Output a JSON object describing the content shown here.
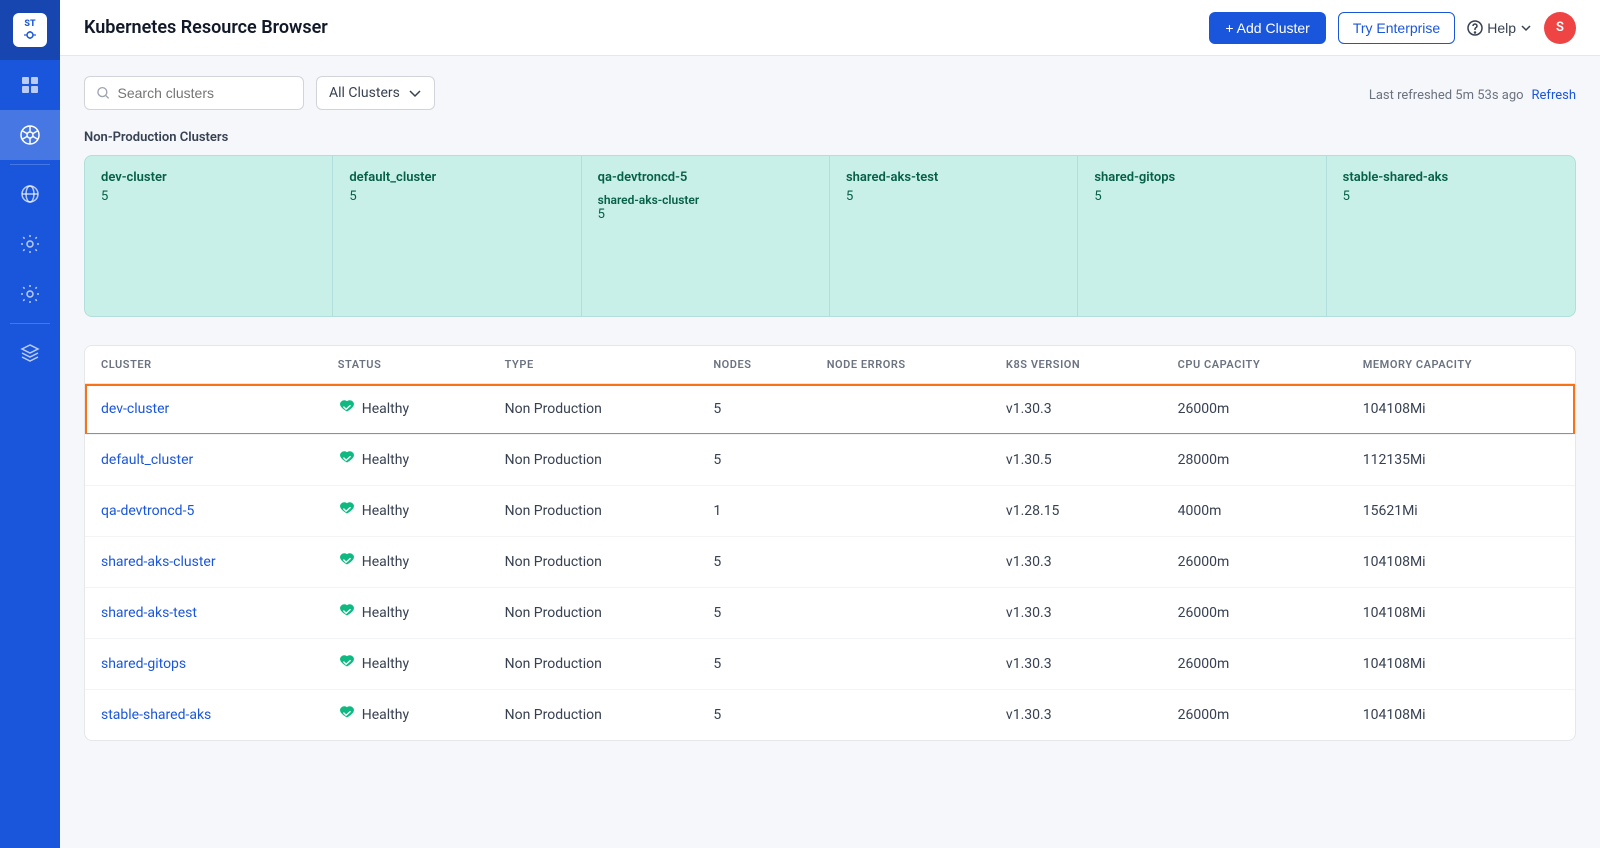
{
  "app": {
    "title": "Kubernetes Resource Browser",
    "logo_text": "ST",
    "avatar_letter": "S"
  },
  "topbar": {
    "add_cluster_label": "+ Add Cluster",
    "try_enterprise_label": "Try Enterprise",
    "help_label": "Help",
    "avatar_letter": "S"
  },
  "filter": {
    "search_placeholder": "Search clusters",
    "cluster_filter_label": "All Clusters",
    "refresh_text": "Last refreshed 5m 53s ago",
    "refresh_label": "Refresh"
  },
  "cluster_cards_section": {
    "title": "Non-Production Clusters",
    "cards": [
      {
        "name": "dev-cluster",
        "count": "5"
      },
      {
        "name": "default_cluster",
        "count": "5"
      },
      {
        "name": "qa-devtroncd-5",
        "count": "",
        "sub_name": "shared-aks-cluster",
        "sub_count": "5"
      },
      {
        "name": "shared-aks-test",
        "count": "5"
      },
      {
        "name": "shared-gitops",
        "count": "5"
      },
      {
        "name": "stable-shared-aks",
        "count": "5"
      }
    ]
  },
  "table": {
    "columns": [
      "CLUSTER",
      "STATUS",
      "TYPE",
      "NODES",
      "NODE ERRORS",
      "K8S VERSION",
      "CPU CAPACITY",
      "MEMORY CAPACITY"
    ],
    "rows": [
      {
        "cluster": "dev-cluster",
        "status": "Healthy",
        "type": "Non Production",
        "nodes": "5",
        "node_errors": "",
        "k8s_version": "v1.30.3",
        "cpu_capacity": "26000m",
        "memory_capacity": "104108Mi",
        "selected": true
      },
      {
        "cluster": "default_cluster",
        "status": "Healthy",
        "type": "Non Production",
        "nodes": "5",
        "node_errors": "",
        "k8s_version": "v1.30.5",
        "cpu_capacity": "28000m",
        "memory_capacity": "112135Mi",
        "selected": false
      },
      {
        "cluster": "qa-devtroncd-5",
        "status": "Healthy",
        "type": "Non Production",
        "nodes": "1",
        "node_errors": "",
        "k8s_version": "v1.28.15",
        "cpu_capacity": "4000m",
        "memory_capacity": "15621Mi",
        "selected": false
      },
      {
        "cluster": "shared-aks-cluster",
        "status": "Healthy",
        "type": "Non Production",
        "nodes": "5",
        "node_errors": "",
        "k8s_version": "v1.30.3",
        "cpu_capacity": "26000m",
        "memory_capacity": "104108Mi",
        "selected": false
      },
      {
        "cluster": "shared-aks-test",
        "status": "Healthy",
        "type": "Non Production",
        "nodes": "5",
        "node_errors": "",
        "k8s_version": "v1.30.3",
        "cpu_capacity": "26000m",
        "memory_capacity": "104108Mi",
        "selected": false
      },
      {
        "cluster": "shared-gitops",
        "status": "Healthy",
        "type": "Non Production",
        "nodes": "5",
        "node_errors": "",
        "k8s_version": "v1.30.3",
        "cpu_capacity": "26000m",
        "memory_capacity": "104108Mi",
        "selected": false
      },
      {
        "cluster": "stable-shared-aks",
        "status": "Healthy",
        "type": "Non Production",
        "nodes": "5",
        "node_errors": "",
        "k8s_version": "v1.30.3",
        "cpu_capacity": "26000m",
        "memory_capacity": "104108Mi",
        "selected": false
      }
    ]
  },
  "sidebar": {
    "icons": [
      {
        "name": "apps-icon",
        "symbol": "⊞",
        "active": false
      },
      {
        "name": "kubernetes-icon",
        "symbol": "⎈",
        "active": true
      },
      {
        "name": "globe-icon",
        "symbol": "◎",
        "active": false
      },
      {
        "name": "settings-icon",
        "symbol": "⚙",
        "active": false
      },
      {
        "name": "config-icon",
        "symbol": "⚙",
        "active": false
      },
      {
        "name": "layers-icon",
        "symbol": "≡",
        "active": false
      }
    ]
  }
}
